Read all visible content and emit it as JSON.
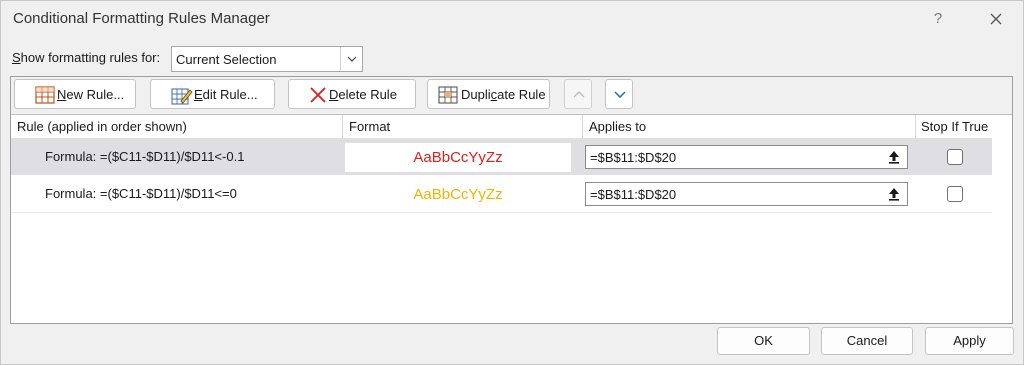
{
  "window": {
    "title": "Conditional Formatting Rules Manager",
    "help_label": "?"
  },
  "scope": {
    "label_pre": "",
    "label_ul": "S",
    "label_post": "how formatting rules for:",
    "selected": "Current Selection"
  },
  "toolbar": {
    "new_rule": {
      "ul": "N",
      "rest": "ew Rule..."
    },
    "edit_rule": {
      "ul": "E",
      "rest": "dit Rule..."
    },
    "delete_rule": {
      "ul": "D",
      "rest": "elete Rule"
    },
    "duplicate_rule": {
      "pre": "Dupli",
      "ul": "c",
      "rest": "ate Rule"
    }
  },
  "columns": [
    "Rule (applied in order shown)",
    "Format",
    "Applies to",
    "Stop If True"
  ],
  "rules": [
    {
      "formula": "Formula: =($C11-$D11)/$D11<-0.1",
      "preview": "AaBbCcYyZz",
      "preview_color": "#e0201c",
      "applies_to": "=$B$11:$D$20",
      "stop_if_true": false,
      "selected": true
    },
    {
      "formula": "Formula: =($C11-$D11)/$D11<=0",
      "preview": "AaBbCcYyZz",
      "preview_color": "#f0b400",
      "applies_to": "=$B$11:$D$20",
      "stop_if_true": false,
      "selected": false
    }
  ],
  "footer": {
    "ok": "OK",
    "cancel": "Cancel",
    "apply": "Apply"
  }
}
